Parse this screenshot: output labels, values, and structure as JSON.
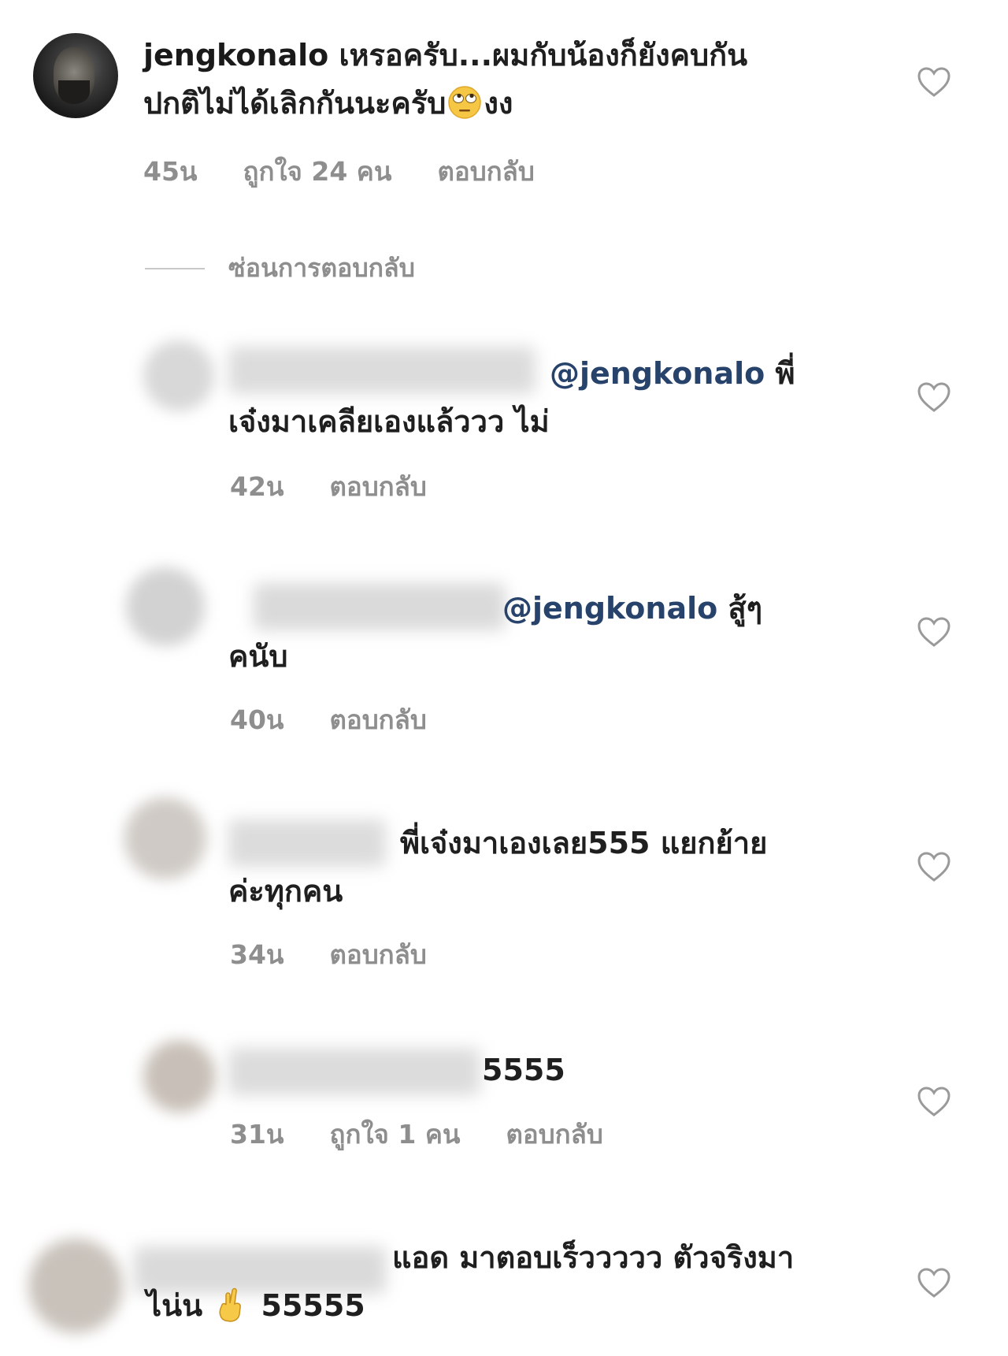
{
  "colors": {
    "mention": "#27436b",
    "meta": "#8e8e8e",
    "text": "#1f1f1f"
  },
  "main_comment": {
    "username": "jengkonalo",
    "text_line1": " เหรอครับ...ผมกับน้องก็ยังคบกัน",
    "text_line2": "ปกติไม่ได้เลิกกันนะครับ",
    "emoji": "face-with-rolling-eyes",
    "text_after_emoji": "งง",
    "time": "45น",
    "likes": "ถูกใจ 24 คน",
    "reply": "ตอบกลับ"
  },
  "hide_replies": "ซ่อนการตอบกลับ",
  "replies": [
    {
      "mention": "@jengkonalo",
      "line1_rest": " พี่",
      "line2": "เจ๋งมาเคลียเองแล้ววว ไม่",
      "time": "42น",
      "likes": "",
      "reply": "ตอบกลับ"
    },
    {
      "mention": "@jengkonalo",
      "line1_rest": " สู้ๆ",
      "line2": "คนับ",
      "time": "40น",
      "likes": "",
      "reply": "ตอบกลับ"
    },
    {
      "mention": "",
      "line1_rest": "พี่เจ๋งมาเองเลย555 แยกย้าย",
      "line2": "ค่ะทุกคน",
      "time": "34น",
      "likes": "",
      "reply": "ตอบกลับ"
    },
    {
      "mention": "",
      "line1_rest": "5555",
      "line2": "",
      "time": "31น",
      "likes": "ถูกใจ 1 คน",
      "reply": "ตอบกลับ"
    },
    {
      "mention": "",
      "line1_rest": "แอด มาตอบเร็ววววว ตัวจริงมา",
      "line2_a": "ไน่น",
      "line2_emoji": "victory-hand",
      "line2_b": " 55555"
    }
  ],
  "icons": {
    "like": "heart-outline-icon"
  }
}
